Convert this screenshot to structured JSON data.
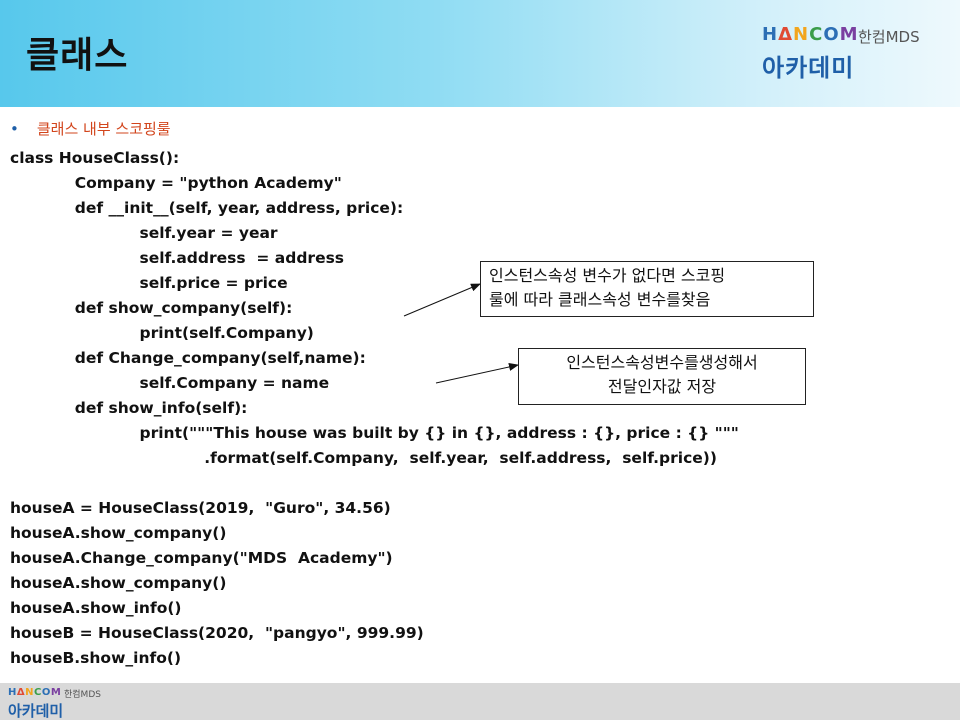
{
  "slide": {
    "title": "클래스",
    "bullet": "클래스 내부 스코핑룰"
  },
  "logo": {
    "brand_letters": [
      "H",
      "Δ",
      "N",
      "C",
      "O",
      "M",
      "M"
    ],
    "brand_text": "HANCOM",
    "sub": "한컴MDS",
    "academy": "아카데미"
  },
  "code_lines": [
    "class HouseClass():",
    "            Company = \"python Academy\"",
    "            def __init__(self, year, address, price):",
    "                        self.year = year",
    "                        self.address  = address",
    "                        self.price = price",
    "            def show_company(self):",
    "                        print(self.Company)",
    "            def Change_company(self,name):",
    "                        self.Company = name",
    "            def show_info(self):",
    "                        print(\"\"\"This house was built by {} in {}, address : {}, price : {} \"\"\"",
    "                                    .format(self.Company,  self.year,  self.address,  self.price))",
    "",
    "houseA = HouseClass(2019,  \"Guro\", 34.56)",
    "houseA.show_company()",
    "houseA.Change_company(\"MDS  Academy\")",
    "houseA.show_company()",
    "houseA.show_info()",
    "houseB = HouseClass(2020,  \"pangyo\", 999.99)",
    "houseB.show_info()"
  ],
  "callouts": {
    "scoping": [
      "인스턴스속성 변수가 없다면 스코핑",
      "룰에 따라 클래스속성 변수를찾음"
    ],
    "create": [
      "인스턴스속성변수를생성해서",
      "전달인자값 저장"
    ]
  },
  "footer": {
    "brand_text": "HANCOM",
    "sub": "한컴MDS",
    "academy": "아카데미"
  }
}
